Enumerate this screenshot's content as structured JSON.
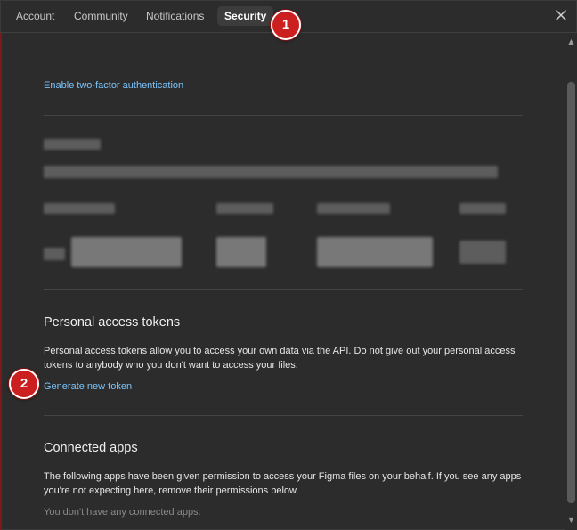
{
  "tabs": [
    {
      "label": "Account"
    },
    {
      "label": "Community"
    },
    {
      "label": "Notifications"
    },
    {
      "label": "Security",
      "active": true
    }
  ],
  "close_icon": "close-icon",
  "security": {
    "two_factor_link": "Enable two-factor authentication"
  },
  "tokens": {
    "heading": "Personal access tokens",
    "description": "Personal access tokens allow you to access your own data via the API. Do not give out your personal access tokens to anybody who you don't want to access your files.",
    "generate_link": "Generate new token"
  },
  "connected_apps": {
    "heading": "Connected apps",
    "description": "The following apps have been given permission to access your Figma files on your behalf. If you see any apps you're not expecting here, remove their permissions below.",
    "empty_message": "You don't have any connected apps."
  },
  "annotations": [
    {
      "number": "1"
    },
    {
      "number": "2"
    }
  ],
  "colors": {
    "background": "#2c2c2c",
    "link": "#7cc4fa",
    "badge": "#cc1f1f"
  }
}
